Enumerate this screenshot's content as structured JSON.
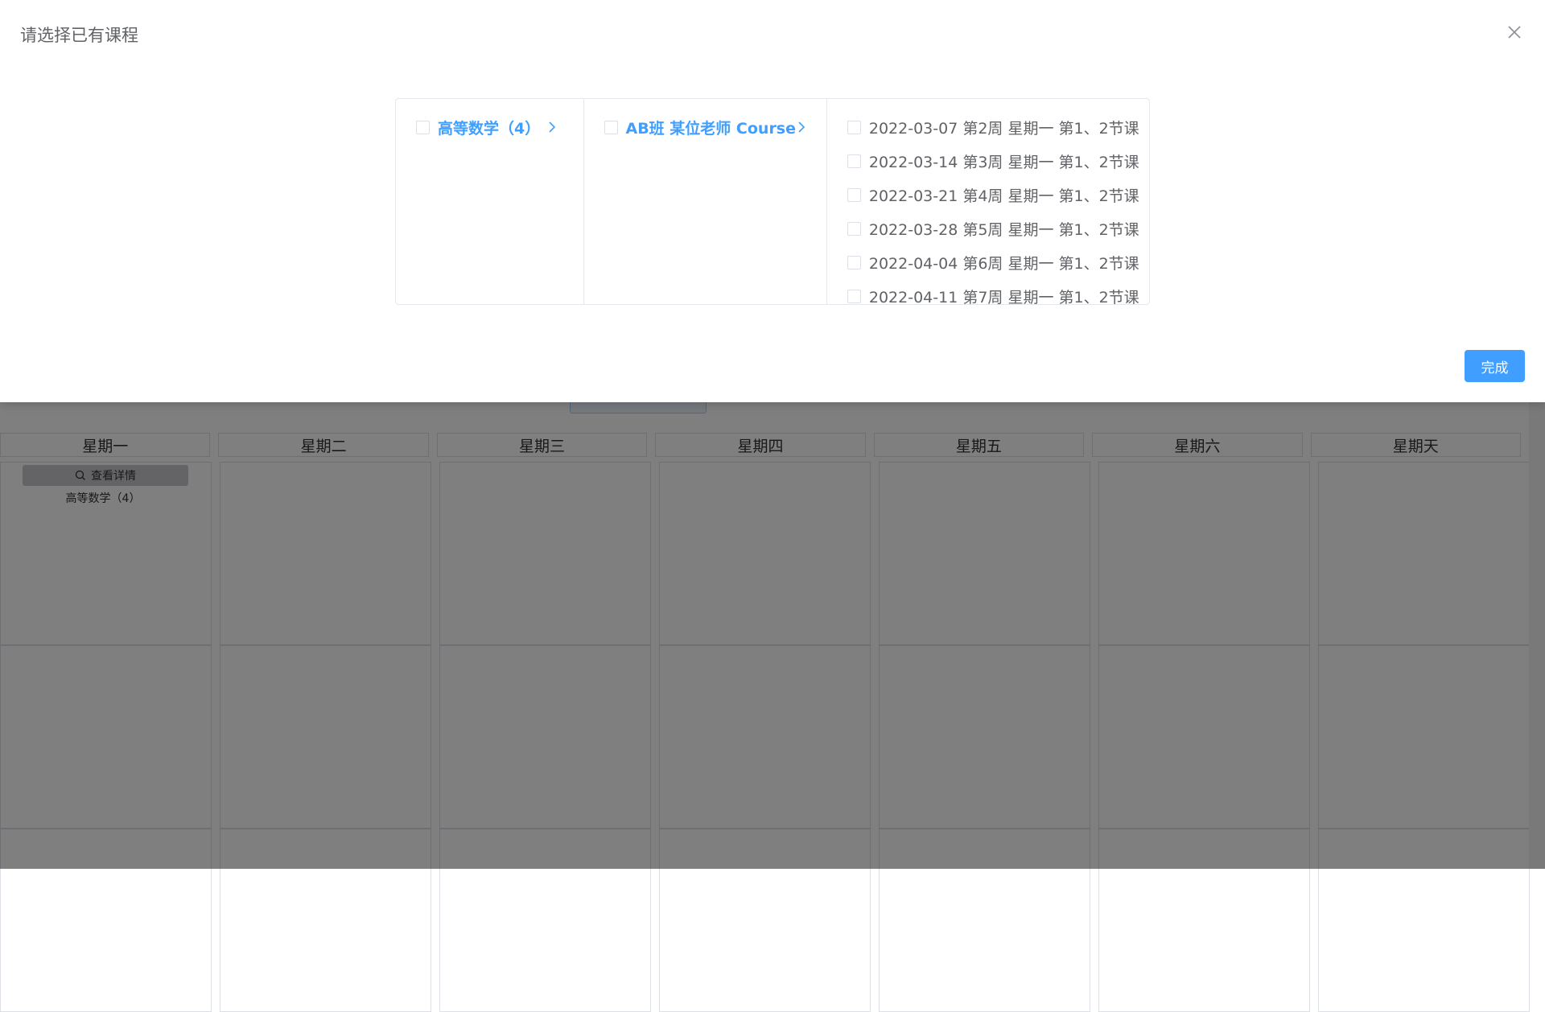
{
  "dialog": {
    "title": "请选择已有课程",
    "done_label": "完成"
  },
  "cascader": {
    "level1": [
      {
        "label": "高等数学（4）"
      }
    ],
    "level2": [
      {
        "label": "AB班 某位老师 Course"
      }
    ],
    "level3": [
      {
        "label": "2022-03-07 第2周 星期一 第1、2节课"
      },
      {
        "label": "2022-03-14 第3周 星期一 第1、2节课"
      },
      {
        "label": "2022-03-21 第4周 星期一 第1、2节课"
      },
      {
        "label": "2022-03-28 第5周 星期一 第1、2节课"
      },
      {
        "label": "2022-04-04 第6周 星期一 第1、2节课"
      },
      {
        "label": "2022-04-11 第7周 星期一 第1、2节课"
      }
    ]
  },
  "schedule": {
    "days": [
      "星期一",
      "星期二",
      "星期三",
      "星期四",
      "星期五",
      "星期六",
      "星期天"
    ],
    "monday_slot": {
      "detail_label": "查看详情",
      "course": "高等数学（4）"
    }
  },
  "colors": {
    "accent": "#409eff",
    "mask": "rgba(0,0,0,0.5)"
  },
  "icons": [
    "close-icon",
    "chevron-right-icon",
    "search-icon",
    "checkbox-icon"
  ]
}
